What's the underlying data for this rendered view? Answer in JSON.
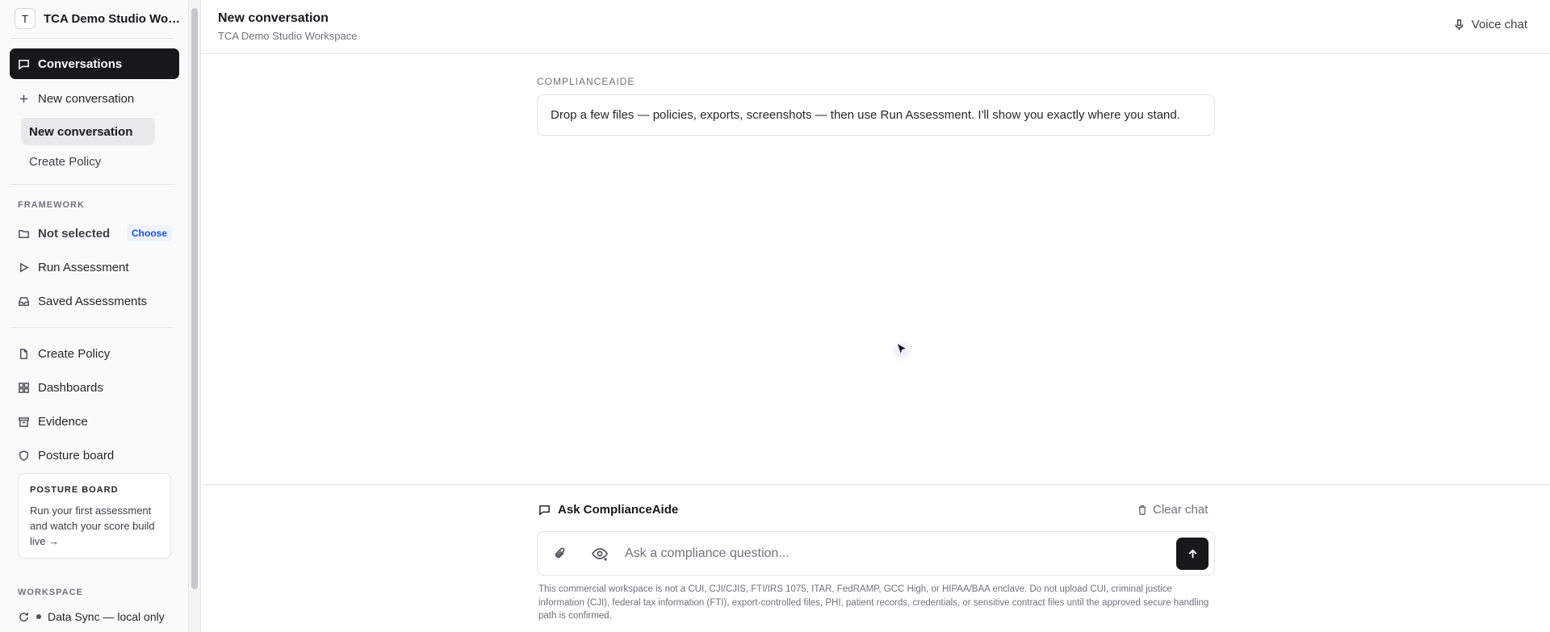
{
  "workspace": {
    "avatar_letter": "T",
    "name": "TCA Demo Studio Workspace"
  },
  "sidebar": {
    "conversations_label": "Conversations",
    "new_conversation_label": "New conversation",
    "conversation_list": [
      "New conversation",
      "Create Policy"
    ],
    "framework_section": "FRAMEWORK",
    "framework_value": "Not selected",
    "framework_choose": "Choose",
    "run_assessment": "Run Assessment",
    "saved_assessments": "Saved Assessments",
    "create_policy": "Create Policy",
    "dashboards": "Dashboards",
    "evidence": "Evidence",
    "posture_board": "Posture board",
    "posture_card": {
      "title": "POSTURE BOARD",
      "body": "Run your first assessment and watch your score build live →"
    },
    "workspace_section": "WORKSPACE",
    "data_sync": "Data Sync — local only"
  },
  "header": {
    "title": "New conversation",
    "subtitle": "TCA Demo Studio Workspace",
    "voice_chat": "Voice chat"
  },
  "chat": {
    "assistant_name": "COMPLIANCEAIDE",
    "assistant_message": "Drop a few files — policies, exports, screenshots — then use Run Assessment. I'll show you exactly where you stand."
  },
  "composer": {
    "ask_label": "Ask ComplianceAide",
    "clear_chat": "Clear chat",
    "placeholder": "Ask a compliance question...",
    "disclaimer": "This commercial workspace is not a CUI, CJI/CJIS, FTI/IRS 1075, ITAR, FedRAMP, GCC High, or HIPAA/BAA enclave. Do not upload CUI, criminal justice information (CJI), federal tax information (FTI), export-controlled files, PHI, patient records, credentials, or sensitive contract files until the approved secure handling path is confirmed."
  },
  "colors": {
    "accent": "#18181b",
    "choose_badge": "#1d4ed8"
  }
}
